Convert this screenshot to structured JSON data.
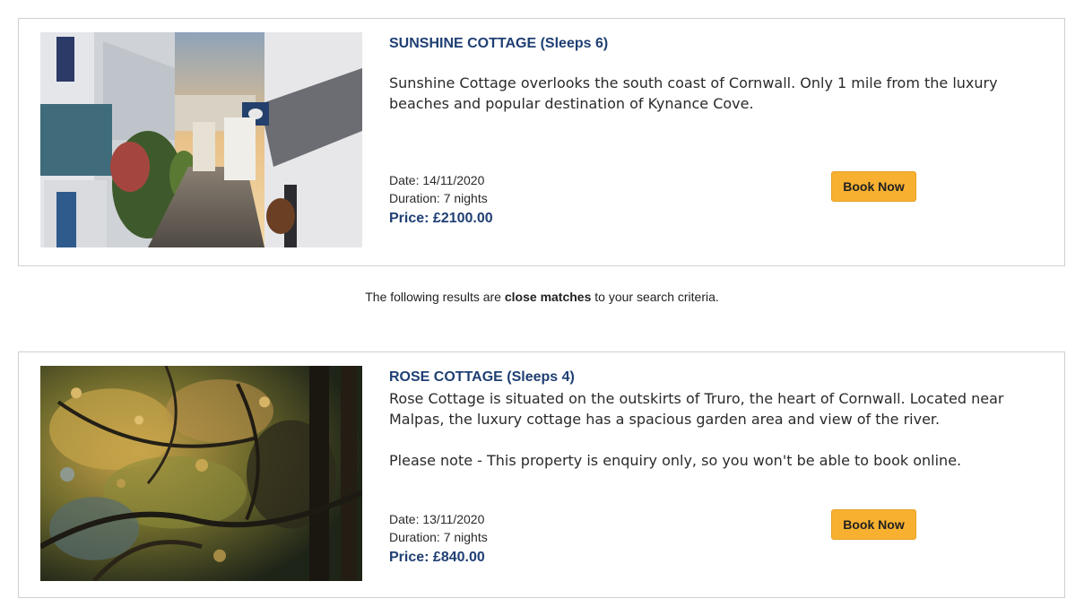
{
  "results": [
    {
      "title": "SUNSHINE COTTAGE (Sleeps 6)",
      "image_icon": "street-photo",
      "description": [
        "Sunshine Cottage overlooks the south coast of Cornwall. Only 1 mile from the luxury beaches and popular destination of Kynance Cove."
      ],
      "date": "Date: 14/11/2020",
      "duration": "Duration: 7 nights",
      "price": "Price: £2100.00",
      "book_label": "Book Now"
    },
    {
      "title": "ROSE COTTAGE (Sleeps 4)",
      "image_icon": "forest-photo",
      "description": [
        "Rose Cottage is situated on the outskirts of Truro, the heart of Cornwall. Located near Malpas, the luxury cottage has a spacious garden area and view of the river.",
        "Please note - This property is enquiry only, so you won't be able to book online."
      ],
      "date": "Date: 13/11/2020",
      "duration": "Duration: 7 nights",
      "price": "Price: £840.00",
      "book_label": "Book Now"
    }
  ],
  "notice": {
    "before": "The following results are ",
    "bold": "close matches",
    "after": " to your search criteria."
  },
  "colors": {
    "title": "#1f3f73",
    "button": "#f7b030",
    "border": "#cfcfcf"
  }
}
